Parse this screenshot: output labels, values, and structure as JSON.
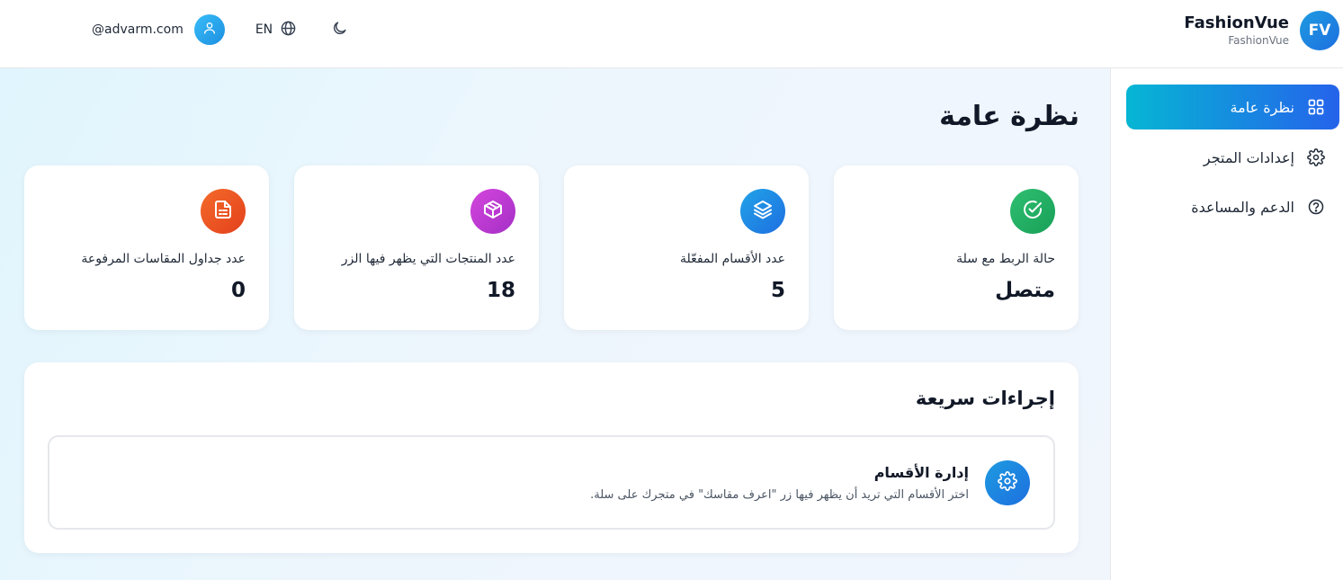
{
  "header": {
    "brand_initials": "FV",
    "brand_name": "FashionVue",
    "brand_subtitle": "FashionVue",
    "user_email": "@advarm.com",
    "language_label": "EN",
    "icons": {
      "user": "user-icon",
      "globe": "globe-icon",
      "theme": "moon-icon"
    }
  },
  "sidebar": {
    "items": [
      {
        "label": "نظرة عامة",
        "icon": "grid-icon",
        "active": true
      },
      {
        "label": "إعدادات المتجر",
        "icon": "gear-icon",
        "active": false
      },
      {
        "label": "الدعم والمساعدة",
        "icon": "help-circle-icon",
        "active": false
      }
    ]
  },
  "main": {
    "title": "نظرة عامة",
    "stats": [
      {
        "label": "حالة الربط مع سلة",
        "value": "متصل",
        "icon": "check-circle-icon",
        "color": "#22a860"
      },
      {
        "label": "عدد الأقسام المفعّلة",
        "value": "5",
        "icon": "layers-icon",
        "color": "#1e8fe0"
      },
      {
        "label": "عدد المنتجات التي يظهر فيها الزر",
        "value": "18",
        "icon": "box-icon",
        "color": "#c23ad6"
      },
      {
        "label": "عدد جداول المقاسات المرفوعة",
        "value": "0",
        "icon": "document-icon",
        "color": "#ef4f1f"
      }
    ],
    "quick_actions": {
      "title": "إجراءات سريعة",
      "items": [
        {
          "title": "إدارة الأقسام",
          "description": "اختر الأقسام التي تريد أن يظهر فيها زر \"اعرف مقاسك\" في متجرك على سلة.",
          "icon": "gear-icon"
        }
      ]
    }
  },
  "colors": {
    "accent_start": "#06b6d4",
    "accent_end": "#2563eb",
    "brand_blue": "#1d6fe0"
  }
}
